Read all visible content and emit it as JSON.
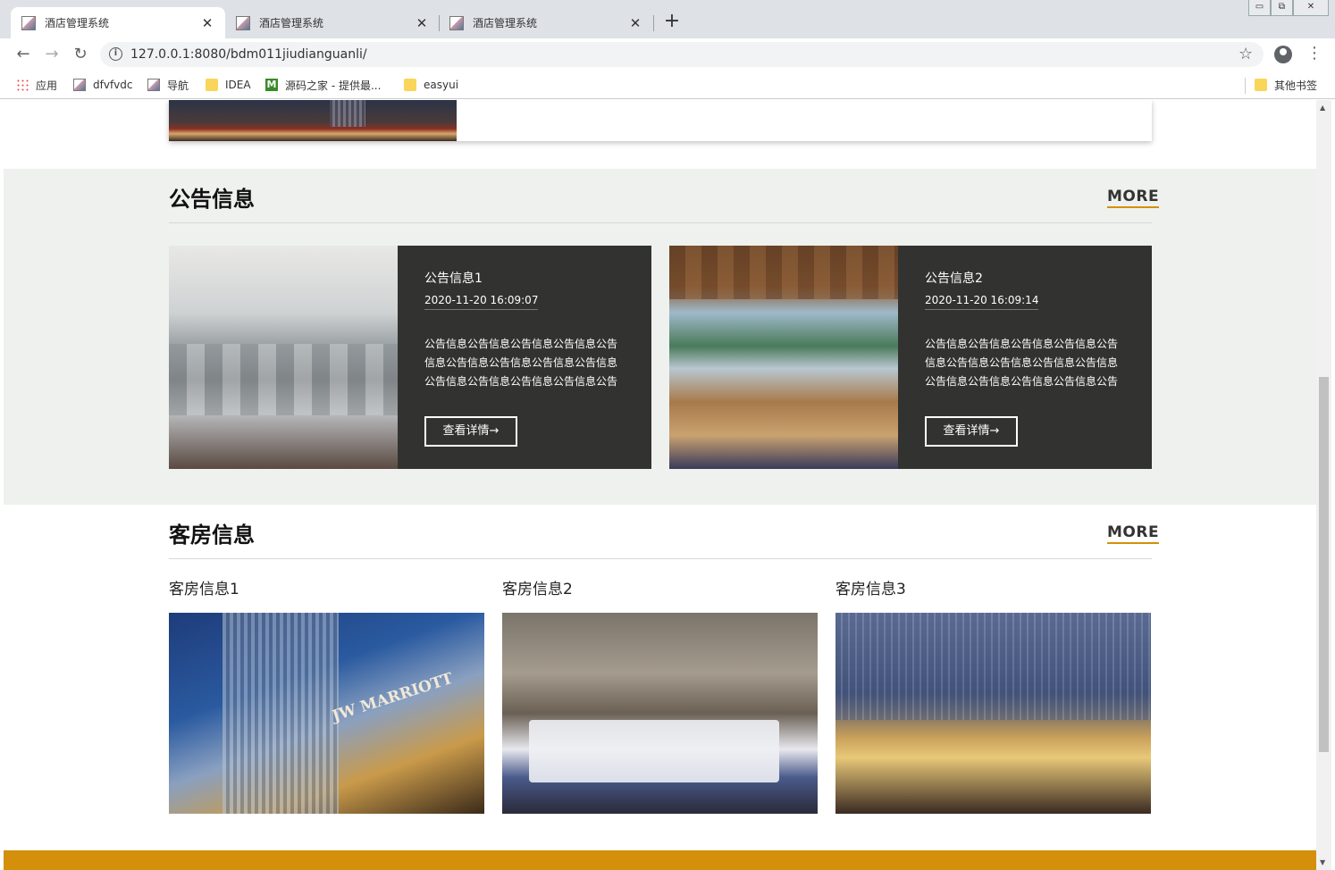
{
  "browser": {
    "tabs": [
      {
        "title": "酒店管理系统",
        "active": true
      },
      {
        "title": "酒店管理系统",
        "active": false
      },
      {
        "title": "酒店管理系统",
        "active": false
      }
    ],
    "new_tab": "+",
    "url": "127.0.0.1:8080/bdm011jiudianguanli/",
    "bookmarks": [
      {
        "label": "应用",
        "icon": "apps-icon"
      },
      {
        "label": "dfvfvdc",
        "icon": "image-icon"
      },
      {
        "label": "导航",
        "icon": "image-icon"
      },
      {
        "label": "IDEA",
        "icon": "folder-icon"
      },
      {
        "label": "源码之家 - 提供最...",
        "icon": "m-icon"
      },
      {
        "label": "easyui",
        "icon": "folder-icon"
      }
    ],
    "other_bookmarks": "其他书签"
  },
  "notice": {
    "title": "公告信息",
    "more": "MORE",
    "items": [
      {
        "title": "公告信息1",
        "date": "2020-11-20 16:09:07",
        "content": "公告信息公告信息公告信息公告信息公告信息公告信息公告信息公告信息公告信息公告信息公告信息公告信息公告信息公告",
        "button": "查看详情→"
      },
      {
        "title": "公告信息2",
        "date": "2020-11-20 16:09:14",
        "content": "公告信息公告信息公告信息公告信息公告信息公告信息公告信息公告信息公告信息公告信息公告信息公告信息公告信息公告",
        "button": "查看详情→"
      }
    ]
  },
  "rooms": {
    "title": "客房信息",
    "more": "MORE",
    "items": [
      {
        "title": "客房信息1"
      },
      {
        "title": "客房信息2"
      },
      {
        "title": "客房信息3"
      }
    ]
  },
  "colors": {
    "accent": "#d4900a",
    "card_bg": "#323330",
    "section_bg": "#eef1ee"
  }
}
